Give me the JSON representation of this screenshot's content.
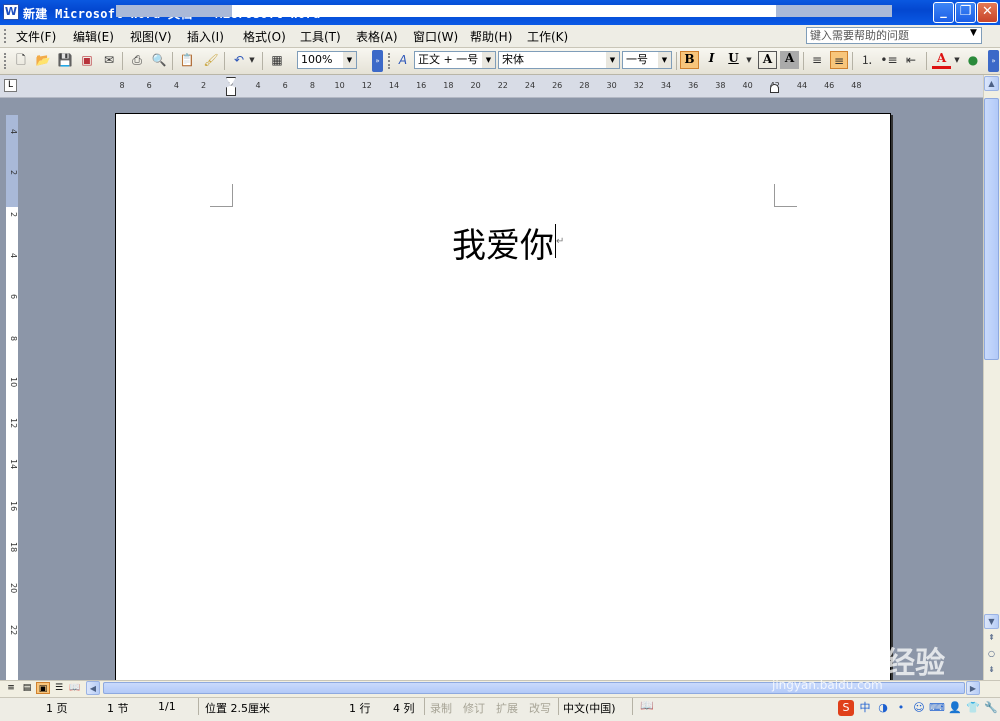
{
  "window": {
    "title": "新建 Microsoft Word 文档 - Microsoft Word",
    "buttons": {
      "minimize": "_",
      "maximize": "❐",
      "close": "✕"
    }
  },
  "menubar": {
    "items": [
      "文件(F)",
      "编辑(E)",
      "视图(V)",
      "插入(I)",
      "格式(O)",
      "工具(T)",
      "表格(A)",
      "窗口(W)",
      "帮助(H)",
      "工作(K)"
    ],
    "help_placeholder": "键入需要帮助的问题"
  },
  "toolbar": {
    "zoom": "100%",
    "style": "正文 + 一号",
    "font": "宋体",
    "size": "一号",
    "bold": "B",
    "italic": "I",
    "underline": "U",
    "char_border": "A",
    "char_shading": "A",
    "font_color": "A"
  },
  "ruler": {
    "h_ticks": [
      "8",
      "6",
      "4",
      "2",
      "2",
      "4",
      "6",
      "8",
      "10",
      "12",
      "14",
      "16",
      "18",
      "20",
      "22",
      "24",
      "26",
      "28",
      "30",
      "32",
      "34",
      "36",
      "38",
      "40",
      "42",
      "44",
      "46",
      "48"
    ],
    "v_ticks": [
      "4",
      "2",
      "2",
      "4",
      "6",
      "8",
      "10",
      "12",
      "14",
      "16",
      "18",
      "20",
      "22"
    ]
  },
  "document": {
    "text": "我爱你"
  },
  "statusbar": {
    "page": "1 页",
    "section": "1 节",
    "page_of": "1/1",
    "position": "位置 2.5厘米",
    "line": "1 行",
    "column": "4 列",
    "rec": "录制",
    "trk": "修订",
    "ext": "扩展",
    "ovr": "改写",
    "language": "中文(中国)"
  },
  "watermark": {
    "text": "Bai du 经验",
    "url": "jingyan.baidu.com"
  }
}
